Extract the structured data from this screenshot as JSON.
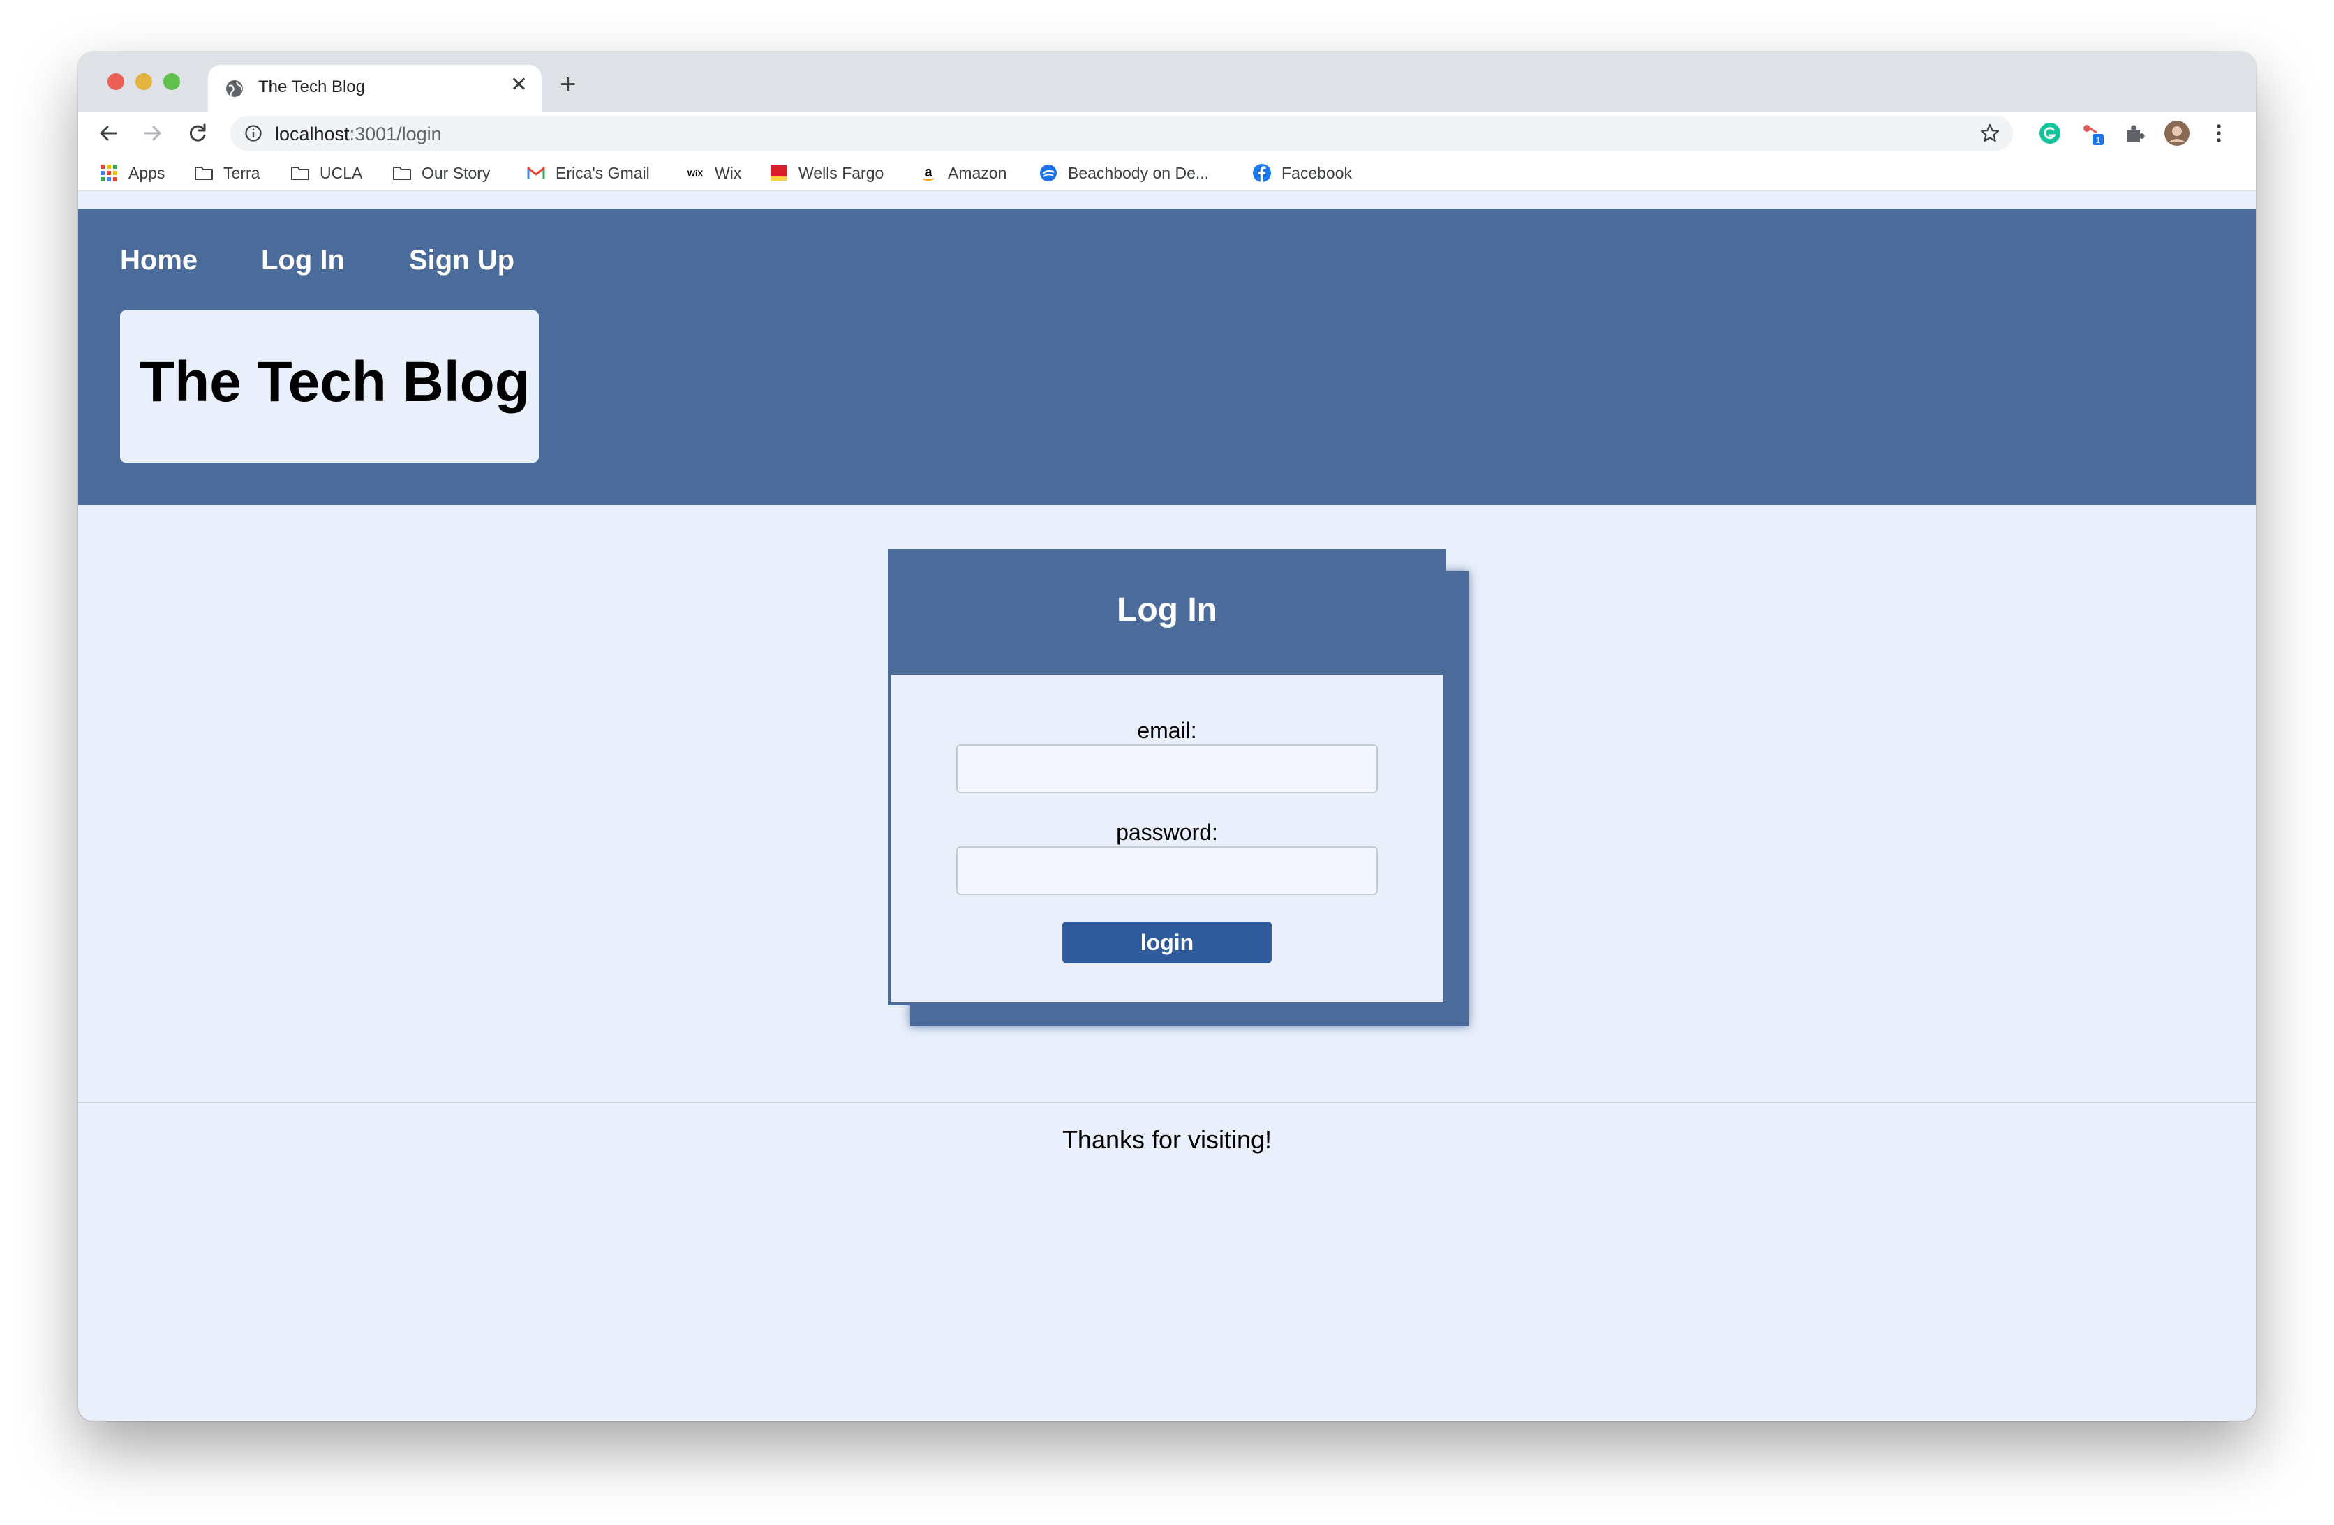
{
  "browser": {
    "tab_title": "The Tech Blog",
    "tab_close": "✕",
    "new_tab": "+",
    "url_host": "localhost",
    "url_path": ":3001/login"
  },
  "bookmarks": [
    {
      "label": "Apps",
      "icon": "apps-grid-icon"
    },
    {
      "label": "Terra",
      "icon": "folder-icon"
    },
    {
      "label": "UCLA",
      "icon": "folder-icon"
    },
    {
      "label": "Our Story",
      "icon": "folder-icon"
    },
    {
      "label": "Erica's Gmail",
      "icon": "gmail-icon"
    },
    {
      "label": "Wix",
      "icon": "wix-icon"
    },
    {
      "label": "Wells Fargo",
      "icon": "wells-fargo-icon"
    },
    {
      "label": "Amazon",
      "icon": "amazon-icon"
    },
    {
      "label": "Beachbody on De...",
      "icon": "beachbody-icon"
    },
    {
      "label": "Facebook",
      "icon": "facebook-icon"
    }
  ],
  "site": {
    "nav": [
      "Home",
      "Log In",
      "Sign Up"
    ],
    "brand": "The Tech Blog"
  },
  "login": {
    "title": "Log In",
    "email_label": "email:",
    "email_value": "",
    "password_label": "password:",
    "password_value": "",
    "submit_label": "login"
  },
  "footer": {
    "text": "Thanks for visiting!"
  },
  "colors": {
    "header_bg": "#4b6b9a",
    "page_bg": "#e9f0fc",
    "button_bg": "#2f5b9c"
  }
}
